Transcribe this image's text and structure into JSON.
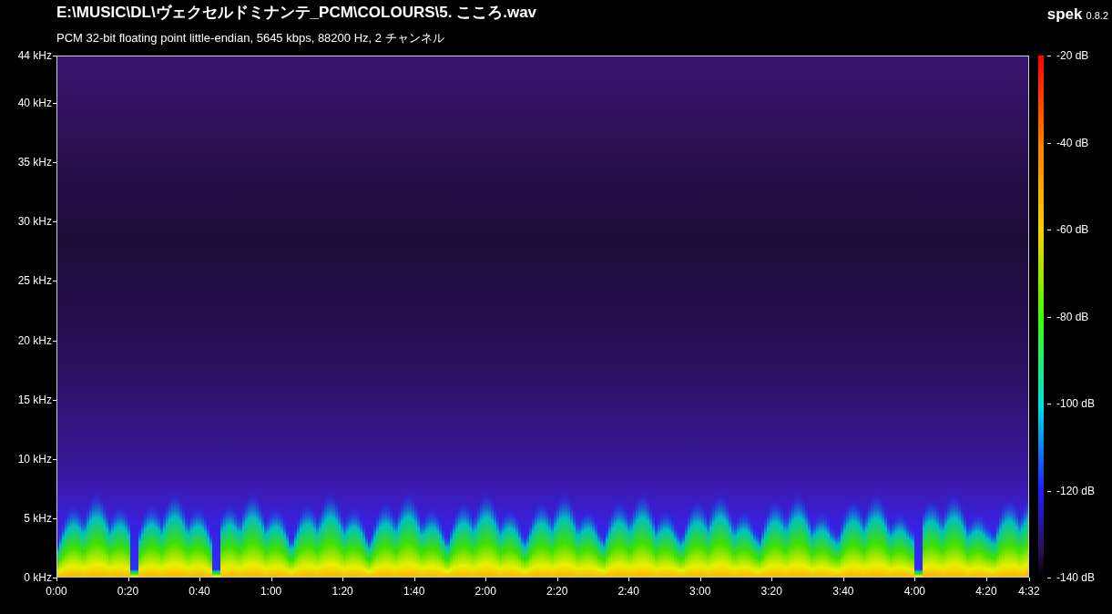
{
  "title": "E:\\MUSIC\\DL\\ヴェクセルドミナンテ_PCM\\COLOURS\\5. こころ.wav",
  "subtitle": "PCM 32-bit floating point little-endian, 5645 kbps, 88200 Hz, 2 チャンネル",
  "app": {
    "name": "spek",
    "version": "0.8.2"
  },
  "frequency_axis": [
    "44 kHz",
    "40 kHz",
    "35 kHz",
    "30 kHz",
    "25 kHz",
    "20 kHz",
    "15 kHz",
    "10 kHz",
    "5 kHz",
    "0 kHz"
  ],
  "time_axis": [
    "0:00",
    "0:20",
    "0:40",
    "1:00",
    "1:20",
    "1:40",
    "2:00",
    "2:20",
    "2:40",
    "3:00",
    "3:20",
    "3:40",
    "4:00",
    "4:20",
    "4:32"
  ],
  "db_scale": [
    "-20 dB",
    "-40 dB",
    "-60 dB",
    "-80 dB",
    "-100 dB",
    "-120 dB",
    "-140 dB"
  ]
}
